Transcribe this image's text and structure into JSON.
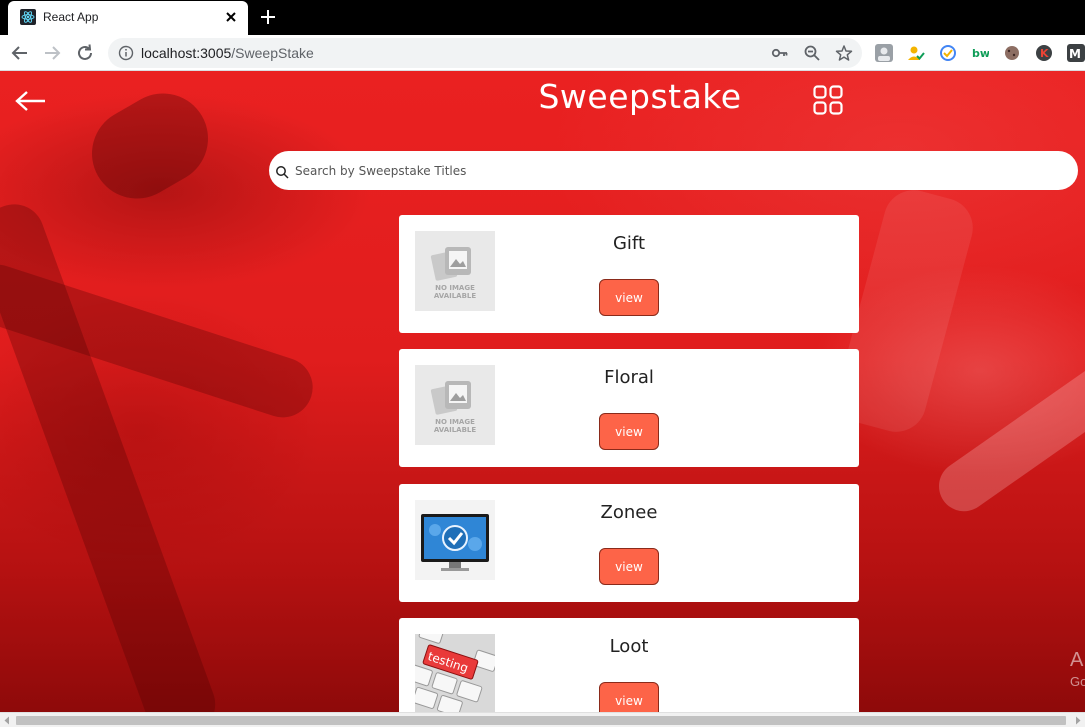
{
  "browser": {
    "tab_title": "React App",
    "url_host": "localhost:3005",
    "url_path": "/SweepStake"
  },
  "page": {
    "title": "Sweepstake",
    "search_placeholder": "Search by Sweepstake Titles",
    "view_label": "view",
    "cards": [
      {
        "title": "Gift",
        "image": "no-image-available",
        "image_text_1": "NO IMAGE",
        "image_text_2": "AVAILABLE"
      },
      {
        "title": "Floral",
        "image": "no-image-available",
        "image_text_1": "NO IMAGE",
        "image_text_2": "AVAILABLE"
      },
      {
        "title": "Zonee",
        "image": "monitor-checkmark"
      },
      {
        "title": "Loot",
        "image": "keyboard-testing",
        "image_text_1": "testing"
      }
    ],
    "watermark_line1": "A",
    "watermark_line2": "Go"
  },
  "colors": {
    "background_red": "#e01d1d",
    "view_button": "#fd6448"
  }
}
